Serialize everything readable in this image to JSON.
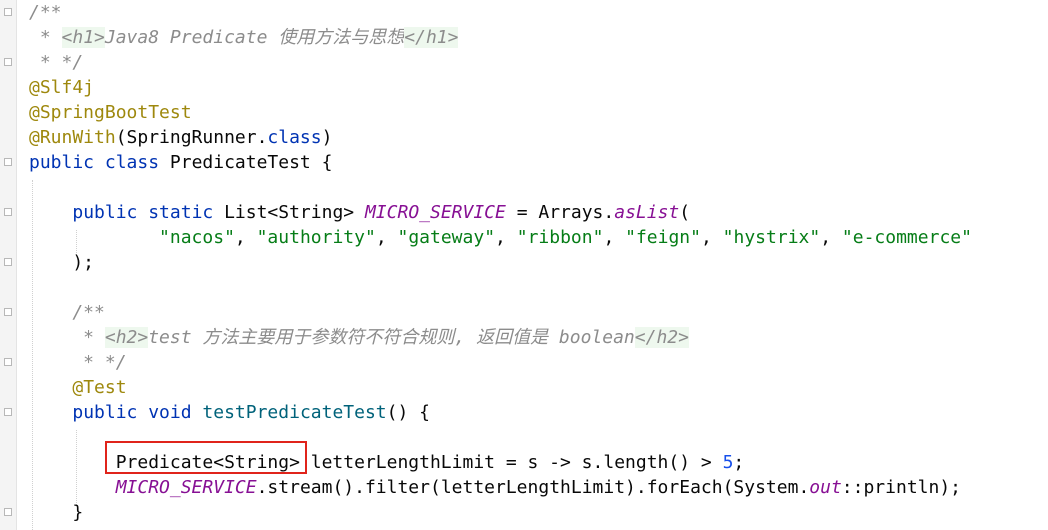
{
  "editor": {
    "lines": [
      {
        "tokens": [
          {
            "t": "c",
            "v": "/**"
          }
        ]
      },
      {
        "tokens": [
          {
            "t": "c",
            "v": " * "
          },
          {
            "t": "tag",
            "v": "<h1>"
          },
          {
            "t": "c",
            "v": "Java8 Predicate 使用方法与思想"
          },
          {
            "t": "tag",
            "v": "</h1>"
          }
        ]
      },
      {
        "tokens": [
          {
            "t": "c",
            "v": " * */"
          }
        ]
      },
      {
        "tokens": [
          {
            "t": "ann",
            "v": "@Slf4j"
          }
        ]
      },
      {
        "tokens": [
          {
            "t": "ann",
            "v": "@SpringBootTest"
          }
        ]
      },
      {
        "tokens": [
          {
            "t": "ann",
            "v": "@RunWith"
          },
          {
            "t": "pl",
            "v": "(SpringRunner."
          },
          {
            "t": "kw",
            "v": "class"
          },
          {
            "t": "pl",
            "v": ")"
          }
        ]
      },
      {
        "tokens": [
          {
            "t": "kw",
            "v": "public class "
          },
          {
            "t": "pl",
            "v": "PredicateTest {"
          }
        ]
      },
      {
        "tokens": []
      },
      {
        "tokens": [
          {
            "t": "pl",
            "v": "    "
          },
          {
            "t": "kw",
            "v": "public static "
          },
          {
            "t": "pl",
            "v": "List<String> "
          },
          {
            "t": "fld",
            "v": "MICRO_SERVICE"
          },
          {
            "t": "pl",
            "v": " = Arrays."
          },
          {
            "t": "st",
            "v": "asList"
          },
          {
            "t": "pl",
            "v": "("
          }
        ]
      },
      {
        "tokens": [
          {
            "t": "pl",
            "v": "            "
          },
          {
            "t": "str",
            "v": "\"nacos\""
          },
          {
            "t": "pl",
            "v": ", "
          },
          {
            "t": "str",
            "v": "\"authority\""
          },
          {
            "t": "pl",
            "v": ", "
          },
          {
            "t": "str",
            "v": "\"gateway\""
          },
          {
            "t": "pl",
            "v": ", "
          },
          {
            "t": "str",
            "v": "\"ribbon\""
          },
          {
            "t": "pl",
            "v": ", "
          },
          {
            "t": "str",
            "v": "\"feign\""
          },
          {
            "t": "pl",
            "v": ", "
          },
          {
            "t": "str",
            "v": "\"hystrix\""
          },
          {
            "t": "pl",
            "v": ", "
          },
          {
            "t": "str",
            "v": "\"e-commerce\""
          }
        ]
      },
      {
        "tokens": [
          {
            "t": "pl",
            "v": "    );"
          }
        ]
      },
      {
        "tokens": []
      },
      {
        "tokens": [
          {
            "t": "c",
            "v": "    /**"
          }
        ]
      },
      {
        "tokens": [
          {
            "t": "c",
            "v": "     * "
          },
          {
            "t": "tag",
            "v": "<h2>"
          },
          {
            "t": "c",
            "v": "test 方法主要用于参数符不符合规则, 返回值是 boolean"
          },
          {
            "t": "tag",
            "v": "</h2>"
          }
        ]
      },
      {
        "tokens": [
          {
            "t": "c",
            "v": "     * */"
          }
        ]
      },
      {
        "tokens": [
          {
            "t": "pl",
            "v": "    "
          },
          {
            "t": "ann",
            "v": "@Test"
          }
        ]
      },
      {
        "tokens": [
          {
            "t": "pl",
            "v": "    "
          },
          {
            "t": "kw",
            "v": "public void "
          },
          {
            "t": "fn",
            "v": "testPredicateTest"
          },
          {
            "t": "pl",
            "v": "() {"
          }
        ]
      },
      {
        "tokens": []
      },
      {
        "tokens": [
          {
            "t": "pl",
            "v": "        Predicate<String> letterLengthLimit = s -> s.length() > "
          },
          {
            "t": "num",
            "v": "5"
          },
          {
            "t": "pl",
            "v": ";"
          }
        ]
      },
      {
        "tokens": [
          {
            "t": "pl",
            "v": "        "
          },
          {
            "t": "fld",
            "v": "MICRO_SERVICE"
          },
          {
            "t": "pl",
            "v": ".stream().filter(letterLengthLimit).forEach(System."
          },
          {
            "t": "fld",
            "v": "out"
          },
          {
            "t": "pl",
            "v": "::println);"
          }
        ]
      },
      {
        "tokens": [
          {
            "t": "pl",
            "v": "    }"
          }
        ]
      }
    ],
    "highlight": {
      "label": "Predicate<String>"
    },
    "colors": {
      "comment": "#8c8c8c",
      "annotation": "#9e880d",
      "keyword": "#0033b3",
      "field": "#871094",
      "string": "#067d17",
      "number": "#1750eb",
      "method": "#00627a",
      "highlight_box": "#e0241b"
    }
  }
}
